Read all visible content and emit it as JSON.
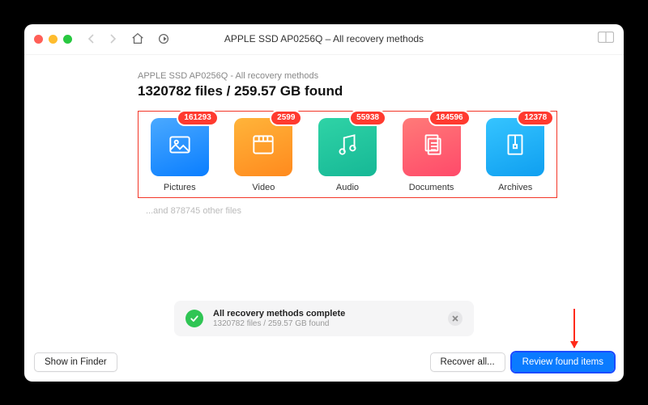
{
  "window": {
    "title": "APPLE SSD AP0256Q – All recovery methods"
  },
  "header": {
    "breadcrumb": "APPLE SSD AP0256Q - All recovery methods",
    "summary": "1320782 files / 259.57 GB found"
  },
  "categories": [
    {
      "id": "pictures",
      "label": "Pictures",
      "count": "161293",
      "grad": "g-blue",
      "icon": "image"
    },
    {
      "id": "video",
      "label": "Video",
      "count": "2599",
      "grad": "g-orange",
      "icon": "film"
    },
    {
      "id": "audio",
      "label": "Audio",
      "count": "55938",
      "grad": "g-teal",
      "icon": "music"
    },
    {
      "id": "documents",
      "label": "Documents",
      "count": "184596",
      "grad": "g-pink",
      "icon": "doc"
    },
    {
      "id": "archives",
      "label": "Archives",
      "count": "12378",
      "grad": "g-sky",
      "icon": "archive"
    }
  ],
  "other_files_line": "...and 878745 other files",
  "status": {
    "title": "All recovery methods complete",
    "subtitle": "1320782 files / 259.57 GB found"
  },
  "footer": {
    "show_in_finder": "Show in Finder",
    "recover_all": "Recover all...",
    "review": "Review found items"
  }
}
